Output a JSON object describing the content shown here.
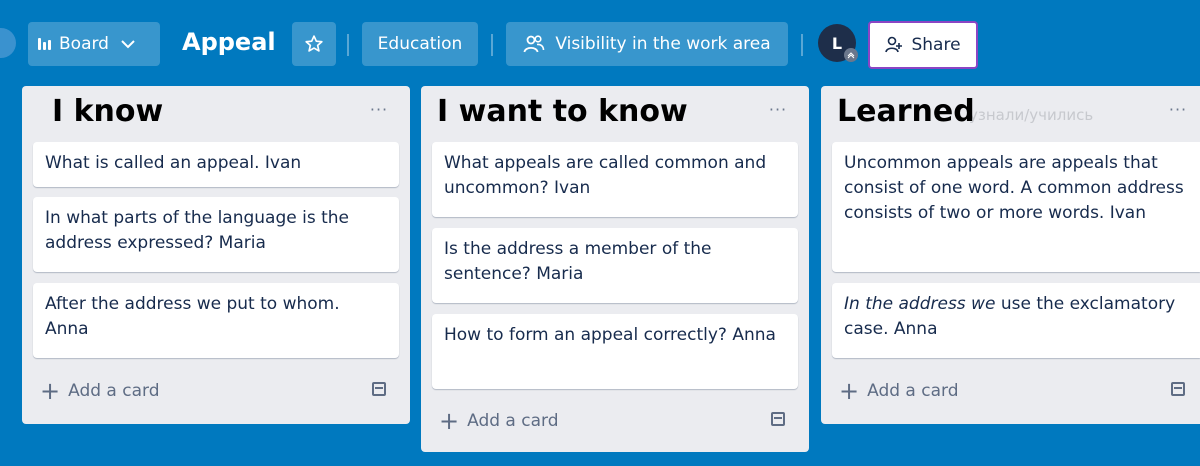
{
  "header": {
    "board_button_label": "Board",
    "board_title": "Appeal",
    "workspace_label": "Education",
    "visibility_label": "Visibility in the work area",
    "avatar_initial": "L",
    "share_label": "Share"
  },
  "lists": [
    {
      "title": "I know",
      "menu": "···",
      "cards": [
        {
          "text": "What is called an appeal. Ivan"
        },
        {
          "text": "In what parts of the language is the address expressed? Maria"
        },
        {
          "text": "After the address we put to whom. Anna"
        }
      ],
      "add_card_label": "Add a card"
    },
    {
      "title": "I want to know",
      "menu": "···",
      "cards": [
        {
          "text": "What appeals are called common and uncommon? Ivan"
        },
        {
          "text": "Is the address a member of the sentence? Maria"
        },
        {
          "text": "How to form an appeal correctly? Anna"
        }
      ],
      "add_card_label": "Add a card"
    },
    {
      "title": "Learned",
      "ghost_text": "узнали/учились",
      "menu": "···",
      "cards": [
        {
          "text": "Uncommon appeals are appeals that consist of one word. A common address consists of two or more words. Ivan"
        },
        {
          "italic_part": "In the address we",
          "text": " use the exclamatory case. Anna"
        }
      ],
      "add_card_label": "Add a card"
    }
  ],
  "colors": {
    "background": "#0079bf",
    "list_background": "#ebecf0",
    "share_border": "#8b44c4",
    "avatar": "#1e2e4a"
  }
}
